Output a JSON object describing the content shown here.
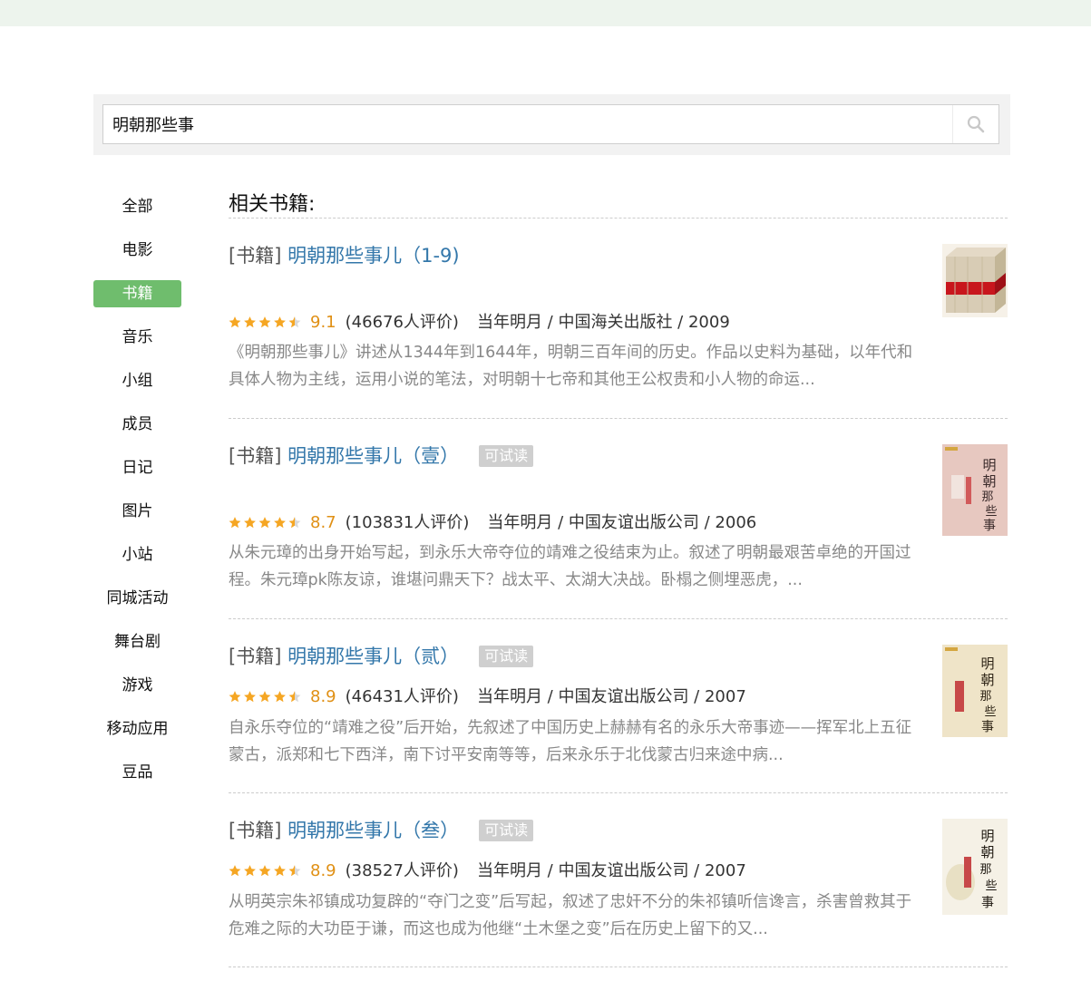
{
  "search": {
    "value": "明朝那些事",
    "placeholder": ""
  },
  "sidebar": {
    "items": [
      {
        "label": "全部"
      },
      {
        "label": "电影"
      },
      {
        "label": "书籍"
      },
      {
        "label": "音乐"
      },
      {
        "label": "小组"
      },
      {
        "label": "成员"
      },
      {
        "label": "日记"
      },
      {
        "label": "图片"
      },
      {
        "label": "小站"
      },
      {
        "label": "同城活动"
      },
      {
        "label": "舞台剧"
      },
      {
        "label": "游戏"
      },
      {
        "label": "移动应用"
      },
      {
        "label": "豆品"
      }
    ],
    "active_index": 2
  },
  "main": {
    "section_title": "相关书籍:",
    "results": [
      {
        "category": "[书籍]",
        "title": "明朝那些事儿（1-9)",
        "trial": "",
        "stars": 4.5,
        "rating": "9.1",
        "count": "(46676人评价)",
        "pub": "当年明月 / 中国海关出版社 / 2009",
        "desc": "《明朝那些事儿》讲述从1344年到1644年，明朝三百年间的历史。作品以史料为基础，以年代和具体人物为主线，运用小说的笔法，对明朝十七帝和其他王公权贵和小人物的命运..."
      },
      {
        "category": "[书籍]",
        "title": "明朝那些事儿（壹）",
        "trial": "可试读",
        "stars": 4.5,
        "rating": "8.7",
        "count": "(103831人评价)",
        "pub": "当年明月 / 中国友谊出版公司 / 2006",
        "desc": "从朱元璋的出身开始写起，到永乐大帝夺位的靖难之役结束为止。叙述了明朝最艰苦卓绝的开国过程。朱元璋pk陈友谅，谁堪问鼎天下？战太平、太湖大决战。卧榻之侧埋恶虎，..."
      },
      {
        "category": "[书籍]",
        "title": "明朝那些事儿（贰）",
        "trial": "可试读",
        "stars": 4.5,
        "rating": "8.9",
        "count": "(46431人评价)",
        "pub": "当年明月 / 中国友谊出版公司 / 2007",
        "desc": "自永乐夺位的“靖难之役”后开始，先叙述了中国历史上赫赫有名的永乐大帝事迹——挥军北上五征蒙古，派郑和七下西洋，南下讨平安南等等，后来永乐于北伐蒙古归来途中病..."
      },
      {
        "category": "[书籍]",
        "title": "明朝那些事儿（叁）",
        "trial": "可试读",
        "stars": 4.5,
        "rating": "8.9",
        "count": "(38527人评价)",
        "pub": "当年明月 / 中国友谊出版公司 / 2007",
        "desc": "从明英宗朱祁镇成功复辟的“夺门之变”后写起，叙述了忠奸不分的朱祁镇听信谗言，杀害曾救其于危难之际的大功臣于谦，而这也成为他继“土木堡之变”后在历史上留下的又..."
      }
    ]
  },
  "colors": {
    "accent": "#6fbd6d",
    "link": "#3377aa",
    "star": "#f5a623",
    "rating": "#e09015",
    "topbar": "#edf4ed"
  },
  "icons": {
    "search": "search-icon",
    "star": "star-icon"
  }
}
